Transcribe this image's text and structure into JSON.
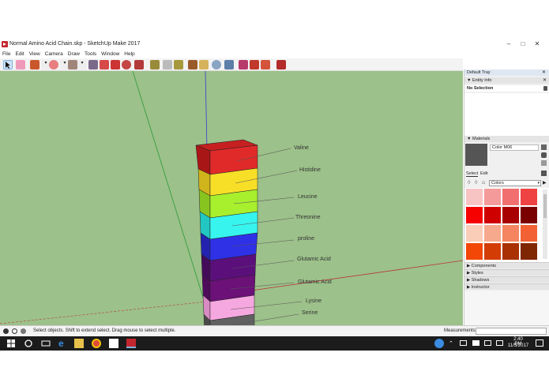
{
  "window": {
    "title": "Normal Amino Acid Chain.skp - SketchUp Make 2017"
  },
  "menu": [
    "File",
    "Edit",
    "View",
    "Camera",
    "Draw",
    "Tools",
    "Window",
    "Help"
  ],
  "labels": [
    {
      "text": "Valine"
    },
    {
      "text": "Histidine"
    },
    {
      "text": "Leucine"
    },
    {
      "text": "Threonine"
    },
    {
      "text": "proline"
    },
    {
      "text": "Glutamic Acid"
    },
    {
      "text": "Glutamic Acid"
    },
    {
      "text": "Lysine"
    },
    {
      "text": "Serine"
    }
  ],
  "segment_colors": [
    "#e02a2a",
    "#f8df27",
    "#a8ef2e",
    "#37f4ef",
    "#2f31e7",
    "#5b0f7b",
    "#6b1178",
    "#f5a8e0",
    "#616161"
  ],
  "tray": {
    "title": "Default Tray",
    "entity_info": "Entity Info",
    "no_selection": "No Selection",
    "materials": "Materials",
    "material_name": "Color M06",
    "select_tab": "Select",
    "edit_tab": "Edit",
    "colors_select": "Colors",
    "components": "Components",
    "styles": "Styles",
    "shadows": "Shadows",
    "instructor": "Instructor"
  },
  "swatches": [
    "#f8c3c3",
    "#f49a9a",
    "#f26f6f",
    "#ef4343",
    "#f70000",
    "#cf0000",
    "#a80000",
    "#7a0000",
    "#f9cdb8",
    "#f6a98c",
    "#f48560",
    "#f16133",
    "#f24707",
    "#d33d05",
    "#a93103",
    "#7f2602"
  ],
  "status": {
    "hint": "Select objects. Shift to extend select. Drag mouse to select multiple.",
    "measurements": "Measurements"
  },
  "clock": {
    "time": "2:40 PM",
    "date": "11/5/2017"
  }
}
